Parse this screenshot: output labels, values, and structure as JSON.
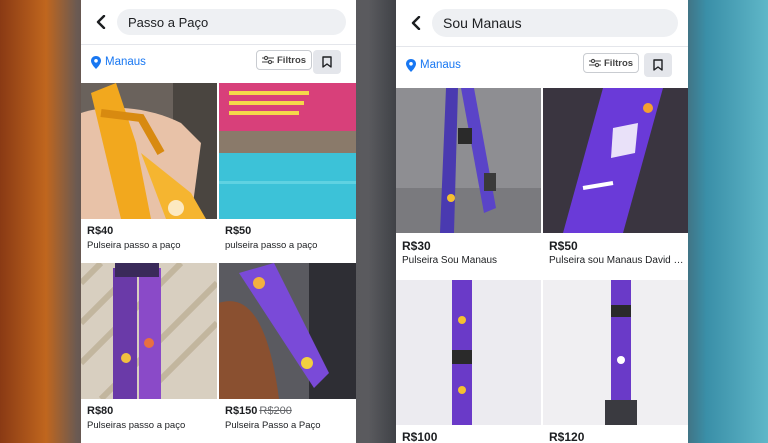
{
  "left": {
    "search_query": "Passo a Paço",
    "location": "Manaus",
    "filters_label": "Filtros",
    "listings": [
      {
        "price": "R$40",
        "title": "Pulseira passo a paço"
      },
      {
        "price": "R$50",
        "title": "pulseira passo a paço"
      },
      {
        "price": "R$80",
        "title": "Pulseiras passo a paço"
      },
      {
        "price": "R$150",
        "old_price": "R$200",
        "title": "Pulseira Passo a Paço"
      }
    ]
  },
  "right": {
    "search_query": "Sou Manaus",
    "location": "Manaus",
    "filters_label": "Filtros",
    "listings": [
      {
        "price": "R$30",
        "title": "Pulseira Sou Manaus"
      },
      {
        "price": "R$50",
        "title": "Pulseira sou Manaus David G..."
      },
      {
        "price": "R$100",
        "title": ""
      },
      {
        "price": "R$120",
        "title": ""
      }
    ]
  },
  "colors": {
    "accent": "#1877f2",
    "text": "#1c1e21",
    "muted": "#65676b",
    "search_bg": "#eef0f3"
  },
  "icons": [
    "back-arrow-icon",
    "location-pin-icon",
    "filter-sliders-icon",
    "bookmark-icon"
  ]
}
